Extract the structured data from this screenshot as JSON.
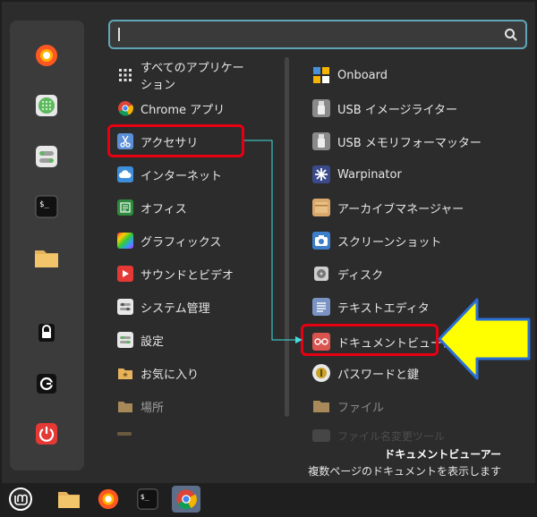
{
  "search": {
    "placeholder": ""
  },
  "favorites": [
    {
      "name": "firefox-icon"
    },
    {
      "name": "software-manager-icon"
    },
    {
      "name": "settings-icon"
    },
    {
      "name": "terminal-icon"
    },
    {
      "name": "files-icon"
    },
    {
      "name": "lock-icon"
    },
    {
      "name": "logout-icon"
    },
    {
      "name": "power-icon"
    }
  ],
  "categories": [
    {
      "label": "すべてのアプリケーション",
      "icon": "grid-icon"
    },
    {
      "label": "Chrome アプリ",
      "icon": "chrome-icon"
    },
    {
      "label": "アクセサリ",
      "icon": "accessories-icon"
    },
    {
      "label": "インターネット",
      "icon": "internet-icon"
    },
    {
      "label": "オフィス",
      "icon": "office-icon"
    },
    {
      "label": "グラフィックス",
      "icon": "graphics-icon"
    },
    {
      "label": "サウンドとビデオ",
      "icon": "media-icon"
    },
    {
      "label": "システム管理",
      "icon": "admin-icon"
    },
    {
      "label": "設定",
      "icon": "settings-icon"
    },
    {
      "label": "お気に入り",
      "icon": "favorites-folder-icon"
    },
    {
      "label": "場所",
      "icon": "places-icon"
    }
  ],
  "apps": [
    {
      "label": "Onboard",
      "icon": "onboard-icon"
    },
    {
      "label": "USB イメージライター",
      "icon": "usb-icon"
    },
    {
      "label": "USB メモリフォーマッター",
      "icon": "usb-icon"
    },
    {
      "label": "Warpinator",
      "icon": "warpinator-icon"
    },
    {
      "label": "アーカイブマネージャー",
      "icon": "archive-icon"
    },
    {
      "label": "スクリーンショット",
      "icon": "screenshot-icon"
    },
    {
      "label": "ディスク",
      "icon": "disk-icon"
    },
    {
      "label": "テキストエディタ",
      "icon": "text-editor-icon"
    },
    {
      "label": "ドキュメントビューアー",
      "icon": "document-viewer-icon"
    },
    {
      "label": "パスワードと鍵",
      "icon": "keys-icon"
    },
    {
      "label": "ファイル",
      "icon": "folder-icon"
    },
    {
      "label": "ファイル名変更ツール",
      "icon": "rename-icon"
    }
  ],
  "description": {
    "title": "ドキュメントビューアー",
    "text": "複数ページのドキュメントを表示します"
  },
  "colors": {
    "highlight": "#e60012",
    "arrow": "#ffff00",
    "connector": "#40e0e0",
    "search_border": "#5fa6b8"
  }
}
